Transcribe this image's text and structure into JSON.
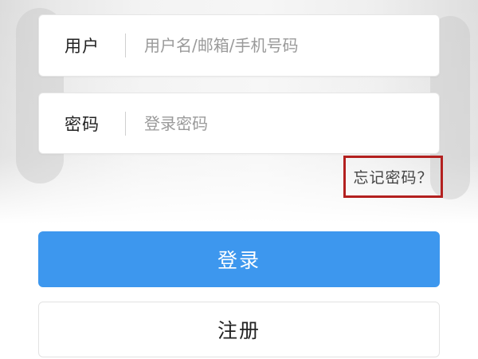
{
  "login_form": {
    "username": {
      "label": "用户",
      "value": "",
      "placeholder": "用户名/邮箱/手机号码"
    },
    "password": {
      "label": "密码",
      "value": "",
      "placeholder": "登录密码"
    },
    "forgot_password_link": "忘记密码？",
    "login_button": "登录",
    "register_button": "注册"
  },
  "colors": {
    "primary_button": "#3d97ee",
    "highlight_frame": "#b3201f"
  }
}
